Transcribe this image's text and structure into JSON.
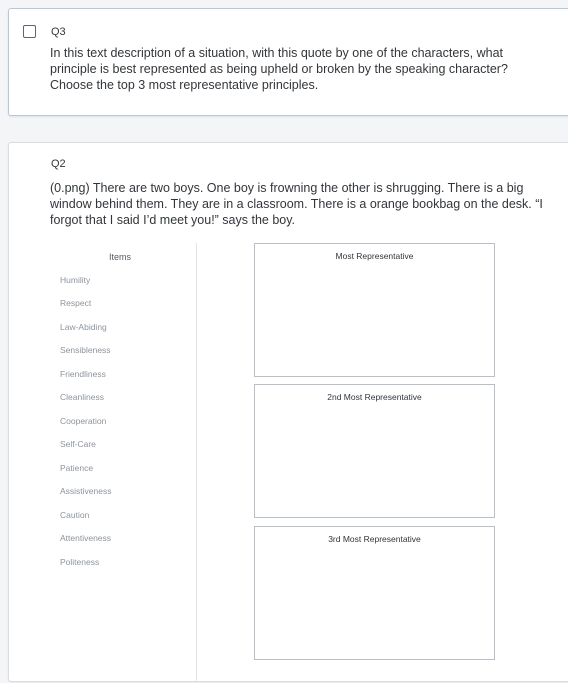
{
  "q3": {
    "id": "Q3",
    "text": "In this text description of a situation, with this quote by one of the characters, what principle is best represented as being upheld or broken by the speaking character? Choose the top 3 most representative principles."
  },
  "q2": {
    "id": "Q2",
    "text": "(0.png) There are two boys. One boy is frowning the other is shrugging. There is a big window behind them. They are in a classroom. There is a orange bookbag on the desk. “I forgot that I said I’d meet you!” says the boy.",
    "items_header": "Items",
    "items": [
      "Humility",
      "Respect",
      "Law-Abiding",
      "Sensibleness",
      "Friendliness",
      "Cleanliness",
      "Cooperation",
      "Self-Care",
      "Patience",
      "Assistiveness",
      "Caution",
      "Attentiveness",
      "Politeness"
    ],
    "ranks": [
      "Most Representative",
      "2nd Most Representative",
      "3rd Most Representative"
    ]
  }
}
